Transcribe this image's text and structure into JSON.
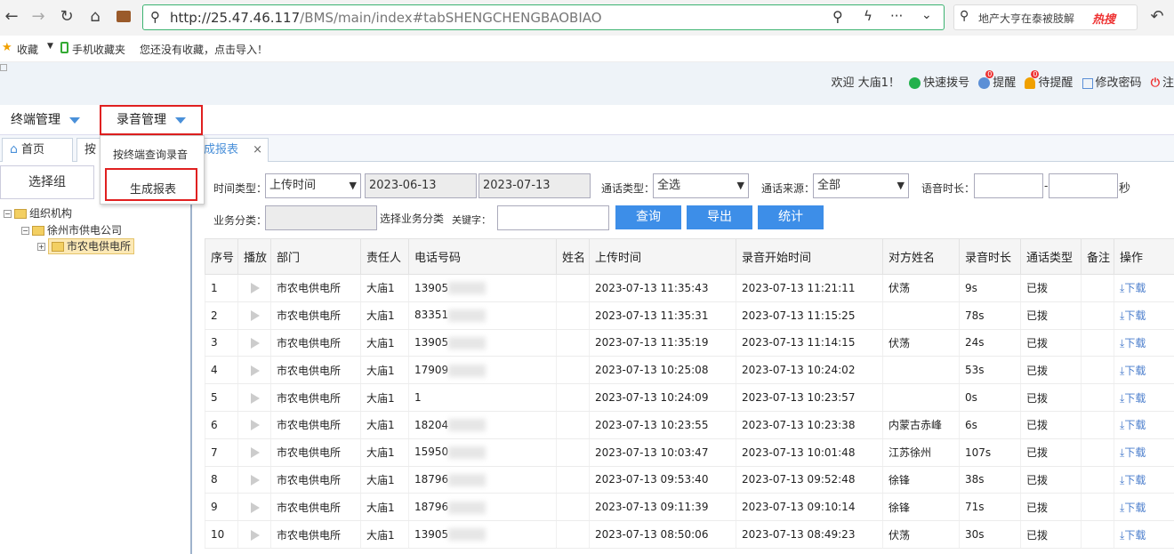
{
  "browser": {
    "url_host": "http://25.47.46.117",
    "url_path": "/BMS/main/index#tabSHENGCHENGBAOBIAO",
    "search_text": "地产大亨在泰被肢解",
    "hot_label": "热搜"
  },
  "bookmarks": {
    "favorites": "收藏",
    "mobile": "手机收藏夹",
    "hint": "您还没有收藏，点击导入！"
  },
  "header": {
    "welcome": "欢迎 大庙1！",
    "quick_dial": "快速拨号",
    "remind": "提醒",
    "remind_badge": "0",
    "pending": "待提醒",
    "pending_badge": "0",
    "change_pwd": "修改密码",
    "logout": "注"
  },
  "menus": {
    "terminal": "终端管理",
    "recording": "录音管理",
    "dropdown": [
      "按终端查询录音",
      "生成报表"
    ]
  },
  "tabs": {
    "home": "首页",
    "partial": "按",
    "report": "成报表"
  },
  "left": {
    "select_group": "选择组",
    "tree": [
      "组织机构",
      "徐州市供电公司",
      "市农电供电所"
    ]
  },
  "filters": {
    "time_type_label": "时间类型：",
    "time_type_value": "上传时间",
    "date_start": "2023-06-13",
    "date_end": "2023-07-13",
    "call_type_label": "通话类型：",
    "call_type_value": "全选",
    "call_source_label": "通话来源：",
    "call_source_value": "全部",
    "duration_label": "语音时长：",
    "dash": "-",
    "seconds": "秒",
    "biz_label": "业务分类：",
    "biz_select": "选择业务分类",
    "keyword_label": "关键字：",
    "btn_query": "查询",
    "btn_export": "导出",
    "btn_stats": "统计"
  },
  "table": {
    "headers": [
      "序号",
      "播放",
      "部门",
      "责任人",
      "电话号码",
      "姓名",
      "上传时间",
      "录音开始时间",
      "对方姓名",
      "录音时长",
      "通话类型",
      "备注",
      "操作"
    ],
    "download": "下载",
    "rows": [
      {
        "no": "1",
        "dept": "市农电供电所",
        "person": "大庙1",
        "phone": "13905",
        "name": "",
        "upload": "2023-07-13 11:35:43",
        "start": "2023-07-13 11:21:11",
        "peer": "伏荡",
        "dur": "9s",
        "type": "已拨",
        "note": ""
      },
      {
        "no": "2",
        "dept": "市农电供电所",
        "person": "大庙1",
        "phone": "83351",
        "name": "",
        "upload": "2023-07-13 11:35:31",
        "start": "2023-07-13 11:15:25",
        "peer": "",
        "dur": "78s",
        "type": "已拨",
        "note": ""
      },
      {
        "no": "3",
        "dept": "市农电供电所",
        "person": "大庙1",
        "phone": "13905",
        "name": "",
        "upload": "2023-07-13 11:35:19",
        "start": "2023-07-13 11:14:15",
        "peer": "伏荡",
        "dur": "24s",
        "type": "已拨",
        "note": ""
      },
      {
        "no": "4",
        "dept": "市农电供电所",
        "person": "大庙1",
        "phone": "17909",
        "name": "",
        "upload": "2023-07-13 10:25:08",
        "start": "2023-07-13 10:24:02",
        "peer": "",
        "dur": "53s",
        "type": "已拨",
        "note": ""
      },
      {
        "no": "5",
        "dept": "市农电供电所",
        "person": "大庙1",
        "phone": "1",
        "name": "",
        "upload": "2023-07-13 10:24:09",
        "start": "2023-07-13 10:23:57",
        "peer": "",
        "dur": "0s",
        "type": "已拨",
        "note": ""
      },
      {
        "no": "6",
        "dept": "市农电供电所",
        "person": "大庙1",
        "phone": "18204",
        "name": "",
        "upload": "2023-07-13 10:23:55",
        "start": "2023-07-13 10:23:38",
        "peer": "内蒙古赤峰",
        "dur": "6s",
        "type": "已拨",
        "note": ""
      },
      {
        "no": "7",
        "dept": "市农电供电所",
        "person": "大庙1",
        "phone": "15950",
        "name": "",
        "upload": "2023-07-13 10:03:47",
        "start": "2023-07-13 10:01:48",
        "peer": "江苏徐州",
        "dur": "107s",
        "type": "已拨",
        "note": ""
      },
      {
        "no": "8",
        "dept": "市农电供电所",
        "person": "大庙1",
        "phone": "18796",
        "name": "",
        "upload": "2023-07-13 09:53:40",
        "start": "2023-07-13 09:52:48",
        "peer": "徐锋",
        "dur": "38s",
        "type": "已拨",
        "note": ""
      },
      {
        "no": "9",
        "dept": "市农电供电所",
        "person": "大庙1",
        "phone": "18796",
        "name": "",
        "upload": "2023-07-13 09:11:39",
        "start": "2023-07-13 09:10:14",
        "peer": "徐锋",
        "dur": "71s",
        "type": "已拨",
        "note": ""
      },
      {
        "no": "10",
        "dept": "市农电供电所",
        "person": "大庙1",
        "phone": "13905",
        "name": "",
        "upload": "2023-07-13 08:50:06",
        "start": "2023-07-13 08:49:23",
        "peer": "伏荡",
        "dur": "30s",
        "type": "已拨",
        "note": ""
      }
    ]
  }
}
